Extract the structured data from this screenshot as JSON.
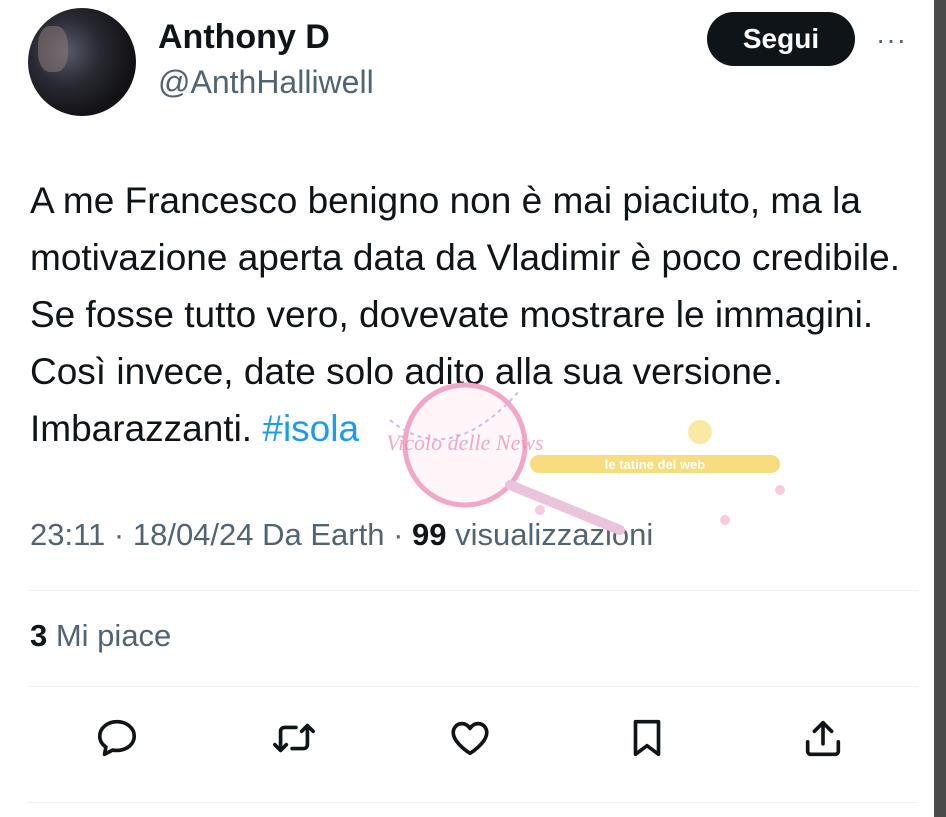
{
  "user": {
    "name": "Anthony D",
    "handle": "@AnthHalliwell"
  },
  "header": {
    "follow_label": "Segui",
    "more_label": "···"
  },
  "tweet": {
    "text": "A me Francesco benigno non è mai piaciuto, ma la motivazione aperta data da Vladimir è poco credibile. Se fosse tutto vero, dovevate mostrare le immagini. Così invece, date solo adito alla sua versione. Imbarazzanti. ",
    "hashtag": "#isola"
  },
  "meta": {
    "time": "23:11",
    "sep1": " · ",
    "date": "18/04/24",
    "source": " Da Earth",
    "sep2": " · ",
    "views": "99",
    "views_label": " visualizzazioni"
  },
  "stats": {
    "likes": "3",
    "likes_label": " Mi piace"
  },
  "actions": [
    "reply-icon",
    "retweet-icon",
    "like-icon",
    "bookmark-icon",
    "share-icon"
  ],
  "colors": {
    "text": "#0f1419",
    "secondary": "#536471",
    "hashtag": "#1d9bf0",
    "button": "#0f1419",
    "divider": "#eff3f4"
  },
  "watermark": {
    "logo_text": "Vicolo delle News",
    "banner_text": "le tatine del web"
  }
}
